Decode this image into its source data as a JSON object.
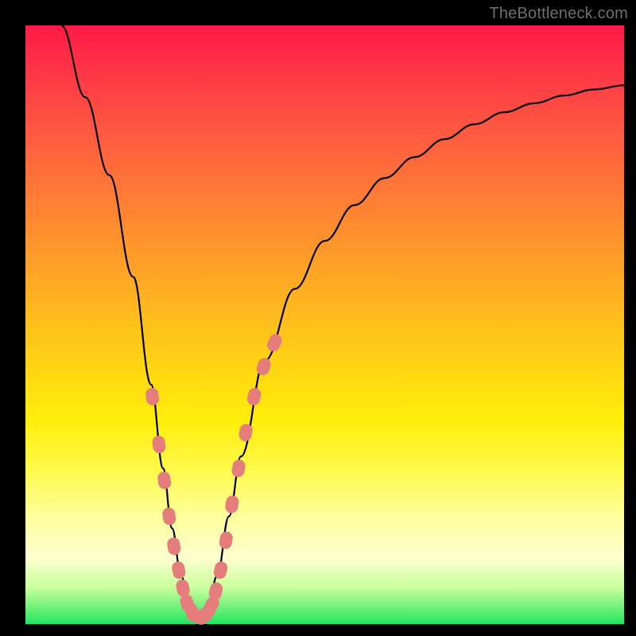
{
  "watermark": "TheBottleneck.com",
  "chart_data": {
    "type": "line",
    "title": "",
    "xlabel": "",
    "ylabel": "",
    "xlim": [
      0,
      100
    ],
    "ylim": [
      0,
      100
    ],
    "series": [
      {
        "name": "curve",
        "x": [
          6,
          10,
          14,
          18,
          21,
          23,
          24.5,
          26,
          27.5,
          29,
          30.5,
          32,
          34,
          36,
          40,
          45,
          50,
          55,
          60,
          65,
          70,
          75,
          80,
          85,
          90,
          95,
          100
        ],
        "y": [
          100,
          88,
          75,
          58,
          40,
          26,
          16,
          8,
          3,
          1,
          3,
          8,
          18,
          28,
          44,
          56,
          64,
          70,
          74.5,
          78,
          81,
          83.5,
          85.5,
          87,
          88.3,
          89.3,
          90
        ]
      },
      {
        "name": "markers-left",
        "x": [
          21.2,
          22.3,
          23.2,
          24.0,
          24.8,
          25.6,
          26.3,
          27.0,
          27.8
        ],
        "y": [
          38,
          30,
          24,
          18,
          13,
          9,
          6,
          3.5,
          2.2
        ]
      },
      {
        "name": "markers-bottom",
        "x": [
          28.3,
          29.0,
          29.7,
          30.4,
          31.1
        ],
        "y": [
          1.4,
          1.1,
          1.3,
          2.0,
          3.2
        ]
      },
      {
        "name": "markers-right",
        "x": [
          31.8,
          32.6,
          33.5,
          34.5,
          35.6,
          36.8,
          38.2,
          39.8,
          41.6
        ],
        "y": [
          5.5,
          9,
          14,
          20,
          26,
          32,
          38,
          43,
          47
        ]
      }
    ],
    "colors": {
      "curve": "#000000",
      "markers": "#e57d7d"
    }
  }
}
